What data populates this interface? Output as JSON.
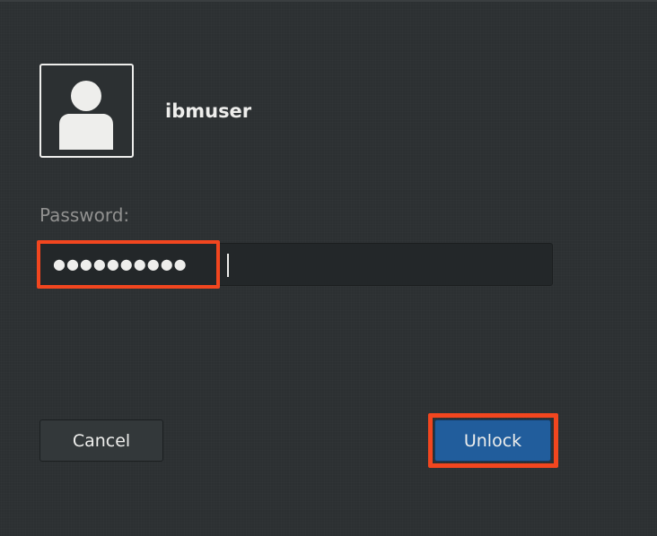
{
  "user": {
    "username": "ibmuser",
    "avatar_icon": "user-silhouette-icon"
  },
  "password": {
    "label": "Password:",
    "masked_value": "●●●●●●●●●●"
  },
  "buttons": {
    "cancel_label": "Cancel",
    "unlock_label": "Unlock"
  },
  "colors": {
    "background": "#2c3032",
    "accent": "#215d9c",
    "highlight": "#f2461f",
    "text": "#eeeeec",
    "label_text": "#919190"
  }
}
